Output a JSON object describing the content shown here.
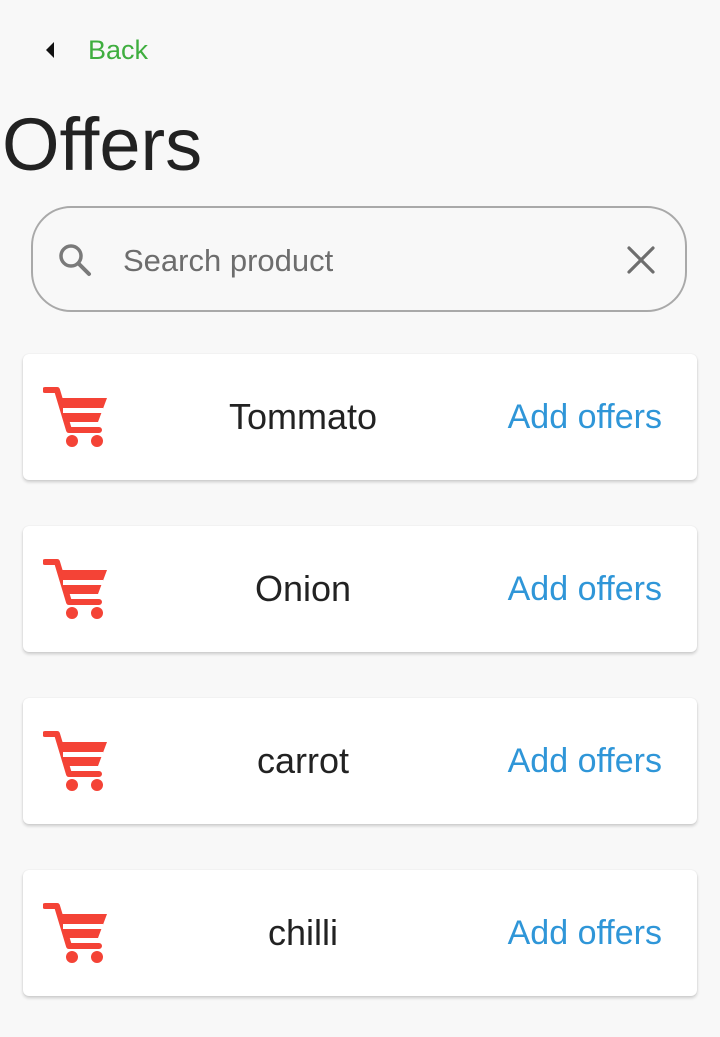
{
  "header": {
    "back_label": "Back",
    "title": "Offers"
  },
  "search": {
    "placeholder": "Search product",
    "value": ""
  },
  "products": [
    {
      "name": "Tommato",
      "action": "Add offers"
    },
    {
      "name": "Onion",
      "action": "Add offers"
    },
    {
      "name": "carrot",
      "action": "Add offers"
    },
    {
      "name": "chilli",
      "action": "Add offers"
    }
  ],
  "icons": {
    "back": "caret-left-icon",
    "search": "search-icon",
    "clear": "close-icon",
    "cart": "shopping-cart-icon"
  },
  "colors": {
    "back_text": "#3fae3f",
    "cart": "#f44336",
    "action": "#2f96d8",
    "title": "#222222",
    "background": "#f8f8f8"
  }
}
